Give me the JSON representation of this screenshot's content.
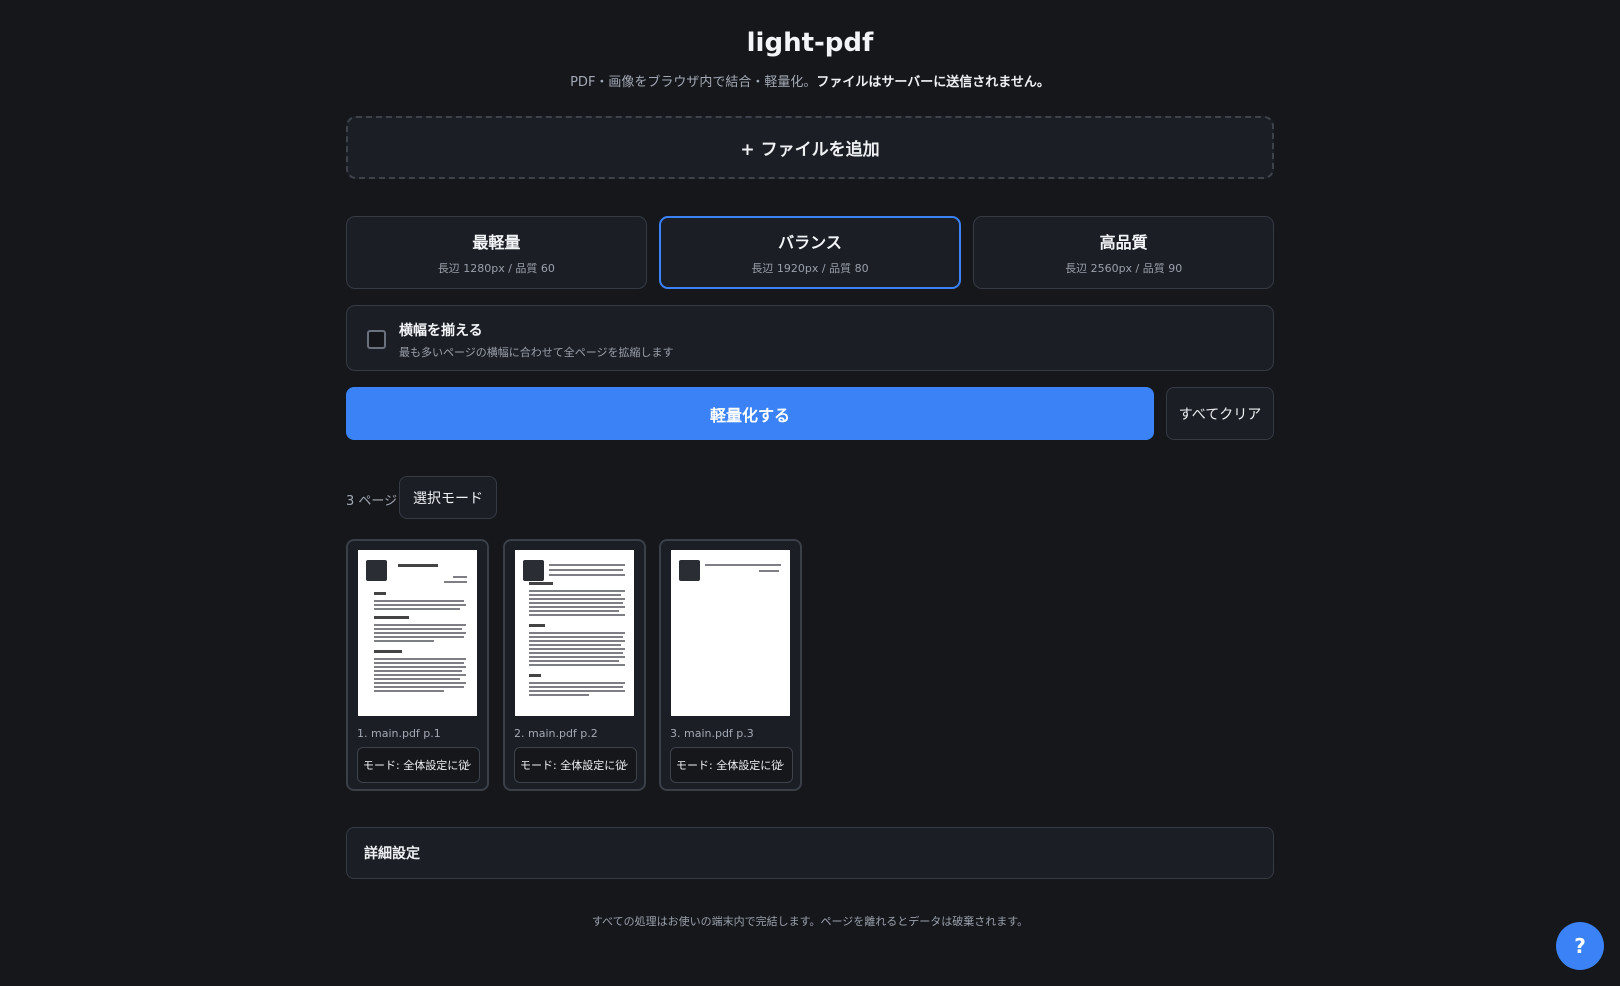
{
  "header": {
    "title": "light-pdf",
    "subtitle_plain": "PDF・画像をブラウザ内で結合・軽量化。",
    "subtitle_bold": "ファイルはサーバーに送信されません。"
  },
  "add_files_label": "+ ファイルを追加",
  "presets": [
    {
      "name": "最軽量",
      "desc": "長辺 1280px / 品質 60",
      "active": false
    },
    {
      "name": "バランス",
      "desc": "長辺 1920px / 品質 80",
      "active": true
    },
    {
      "name": "高品質",
      "desc": "長辺 2560px / 品質 90",
      "active": false
    }
  ],
  "fit_width": {
    "title": "横幅を揃える",
    "desc": "最も多いページの横幅に合わせて全ページを拡縮します",
    "checked": false
  },
  "actions": {
    "compress_label": "軽量化する",
    "clear_label": "すべてクリア"
  },
  "pages_toolbar": {
    "count_label": "3 ページ",
    "select_mode_label": "選択モード"
  },
  "pages": [
    {
      "label": "1. main.pdf p.1",
      "mode": "モード: 全体設定に従"
    },
    {
      "label": "2. main.pdf p.2",
      "mode": "モード: 全体設定に従"
    },
    {
      "label": "3. main.pdf p.3",
      "mode": "モード: 全体設定に従"
    }
  ],
  "advanced_label": "詳細設定",
  "footer_text": "すべての処理はお使いの端末内で完結します。ページを離れるとデータは破棄されます。",
  "help_label": "?",
  "colors": {
    "accent": "#3b82f6",
    "background": "#15171b",
    "card": "#1b1e24"
  }
}
